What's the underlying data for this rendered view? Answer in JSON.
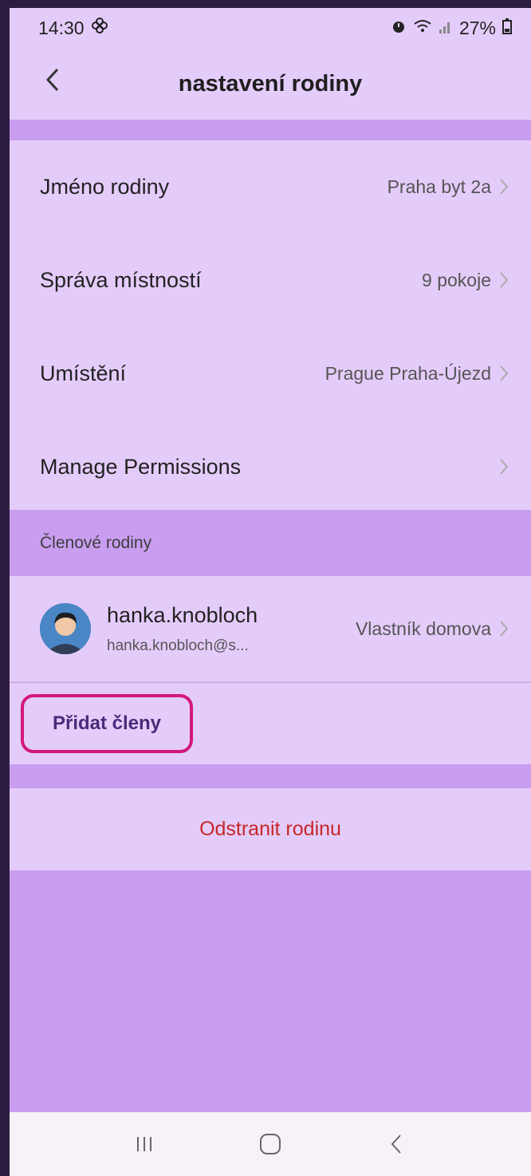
{
  "status_bar": {
    "time": "14:30",
    "battery": "27%"
  },
  "header": {
    "title": "nastavení rodiny",
    "back_icon": "chevron-left-icon"
  },
  "settings": [
    {
      "label": "Jméno rodiny",
      "value": "Praha byt 2a"
    },
    {
      "label": "Správa místností",
      "value": "9 pokoje"
    },
    {
      "label": "Umístění",
      "value": "Prague Praha-Újezd"
    },
    {
      "label": "Manage Permissions",
      "value": ""
    }
  ],
  "members_section": {
    "title": "Členové rodiny",
    "member": {
      "name": "hanka.knobloch",
      "email": "hanka.knobloch@s...",
      "role": "Vlastník domova"
    },
    "add_label": "Přidat členy"
  },
  "delete_label": "Odstranit rodinu",
  "colors": {
    "surface": "#e4ccfa",
    "background": "#c99df0",
    "highlight": "#d3187b",
    "danger": "#c62828"
  }
}
